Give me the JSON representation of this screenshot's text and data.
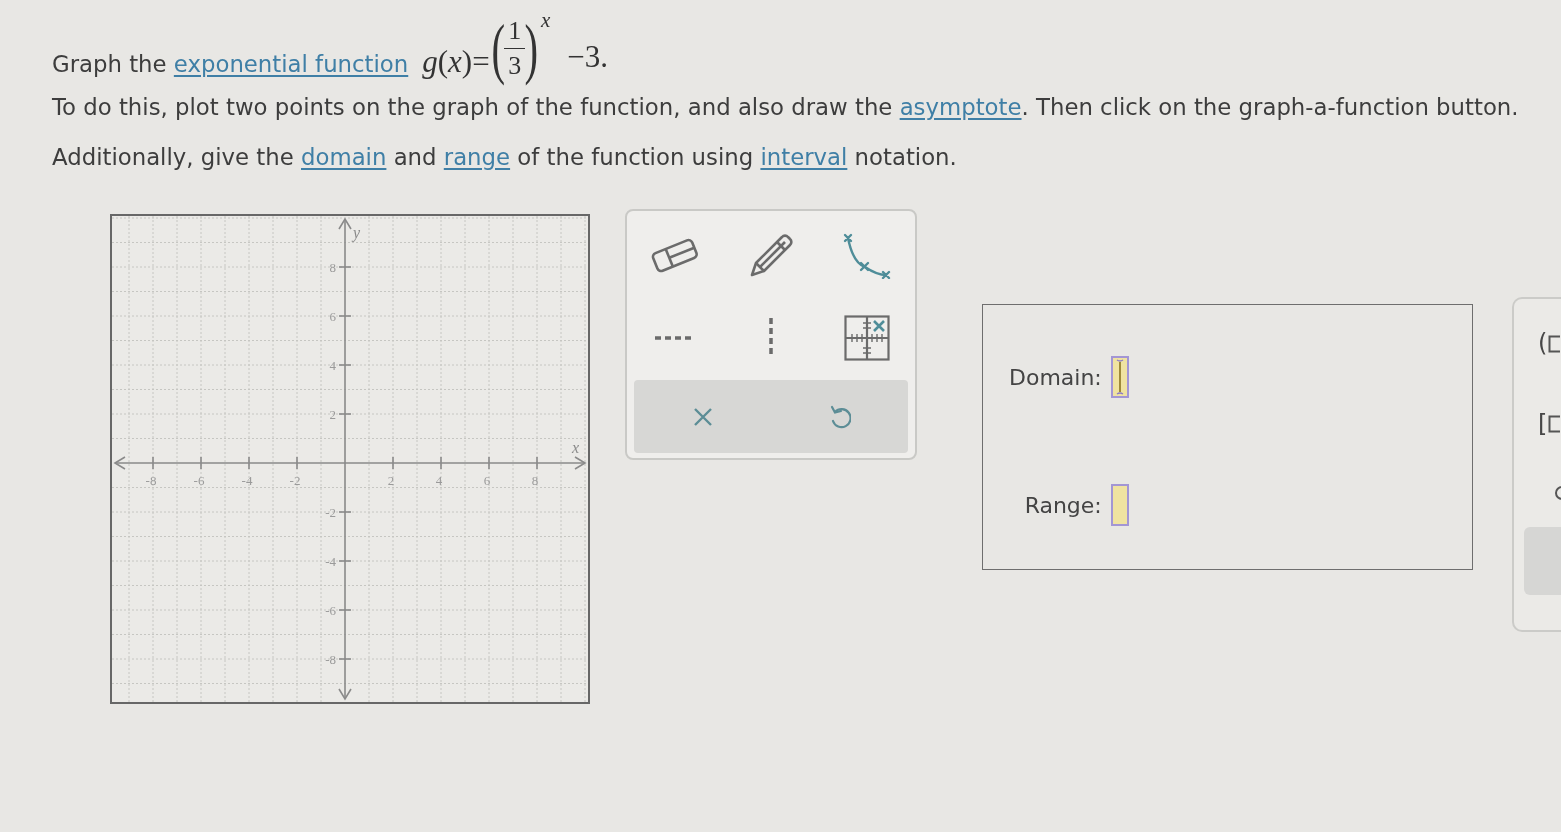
{
  "instructions": [
    {
      "segments": [
        {
          "kind": "text",
          "text": "Graph the "
        },
        {
          "kind": "link",
          "text": "exponential function"
        },
        {
          "kind": "formula",
          "lhs": "*g*(*x*)=",
          "open": "(",
          "numerator": "1",
          "denominator": "3",
          "close": ")",
          "exponent": "x",
          "tail": "−3."
        }
      ]
    },
    {
      "segments": [
        {
          "kind": "text",
          "text": "To do this, plot two points on the graph of the function, and also draw the "
        },
        {
          "kind": "link",
          "text": "asymptote"
        },
        {
          "kind": "text",
          "text": ". Then click on the graph-a-function button."
        }
      ]
    },
    {
      "segments": [
        {
          "kind": "text",
          "text": "Additionally, give the "
        },
        {
          "kind": "link",
          "text": "domain"
        },
        {
          "kind": "text",
          "text": " and "
        },
        {
          "kind": "link",
          "text": "range"
        },
        {
          "kind": "text",
          "text": " of the function using "
        },
        {
          "kind": "link",
          "text": "interval"
        },
        {
          "kind": "text",
          "text": " notation."
        }
      ]
    }
  ],
  "graph": {
    "x_label": "x",
    "y_label": "y",
    "x_ticks": [
      "-8",
      "-6",
      "-4",
      "-2",
      "2",
      "4",
      "6",
      "8"
    ],
    "y_ticks": [
      "8",
      "6",
      "4",
      "2",
      "-2",
      "-4",
      "-6",
      "-8"
    ]
  },
  "answer_box": {
    "fields": [
      {
        "label": "Domain:",
        "focused": true
      },
      {
        "label": "Range:",
        "focused": false
      }
    ]
  },
  "keypad": {
    "keys": [
      {
        "symbol": "("
      },
      {
        "symbol": "["
      }
    ]
  }
}
